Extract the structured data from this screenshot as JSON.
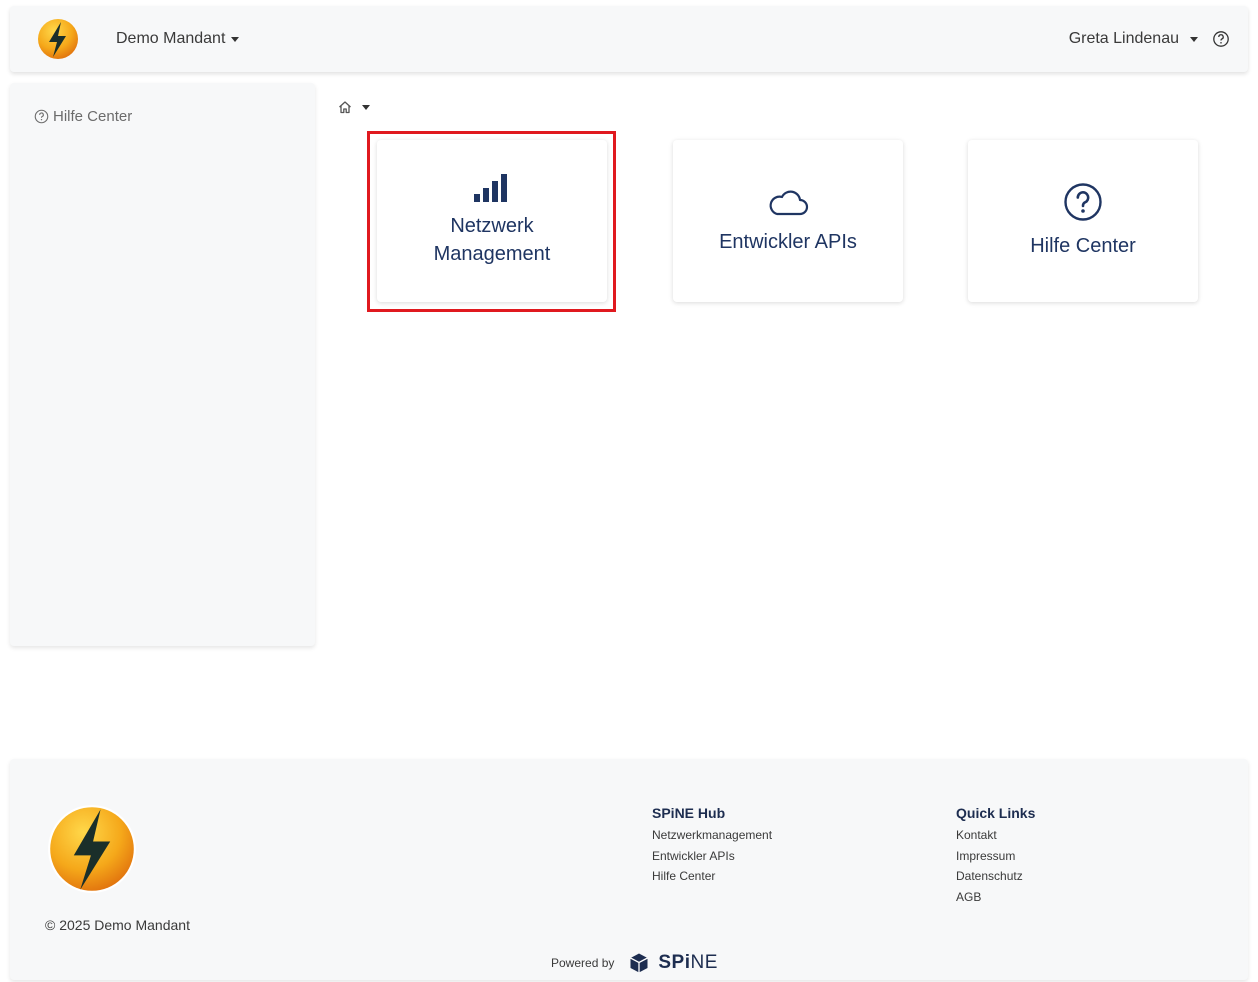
{
  "header": {
    "tenant_label": "Demo Mandant",
    "user_name": "Greta Lindenau"
  },
  "sidebar": {
    "items": [
      {
        "label": "Hilfe Center",
        "icon": "help-circle-icon"
      }
    ]
  },
  "breadcrumb": {
    "icon": "home-icon"
  },
  "cards": [
    {
      "label": "Netzwerk Management",
      "icon": "signal-bars-icon",
      "highlighted": true
    },
    {
      "label": "Entwickler APIs",
      "icon": "cloud-icon"
    },
    {
      "label": "Hilfe Center",
      "icon": "question-circle-icon"
    }
  ],
  "footer": {
    "copyright": "© 2025 Demo Mandant",
    "col1": {
      "title": "SPiNE Hub",
      "links": [
        "Netzwerkmanagement",
        "Entwickler APIs",
        "Hilfe Center"
      ]
    },
    "col2": {
      "title": "Quick Links",
      "links": [
        "Kontakt",
        "Impressum",
        "Datenschutz",
        "AGB"
      ]
    },
    "powered_by": "Powered by",
    "brand_bold": "SPi",
    "brand_light": "NE"
  },
  "colors": {
    "accent": "#1f3562",
    "highlight": "#e0191f",
    "logo_yellow": "#f5b31a",
    "logo_orange": "#e8800d"
  }
}
